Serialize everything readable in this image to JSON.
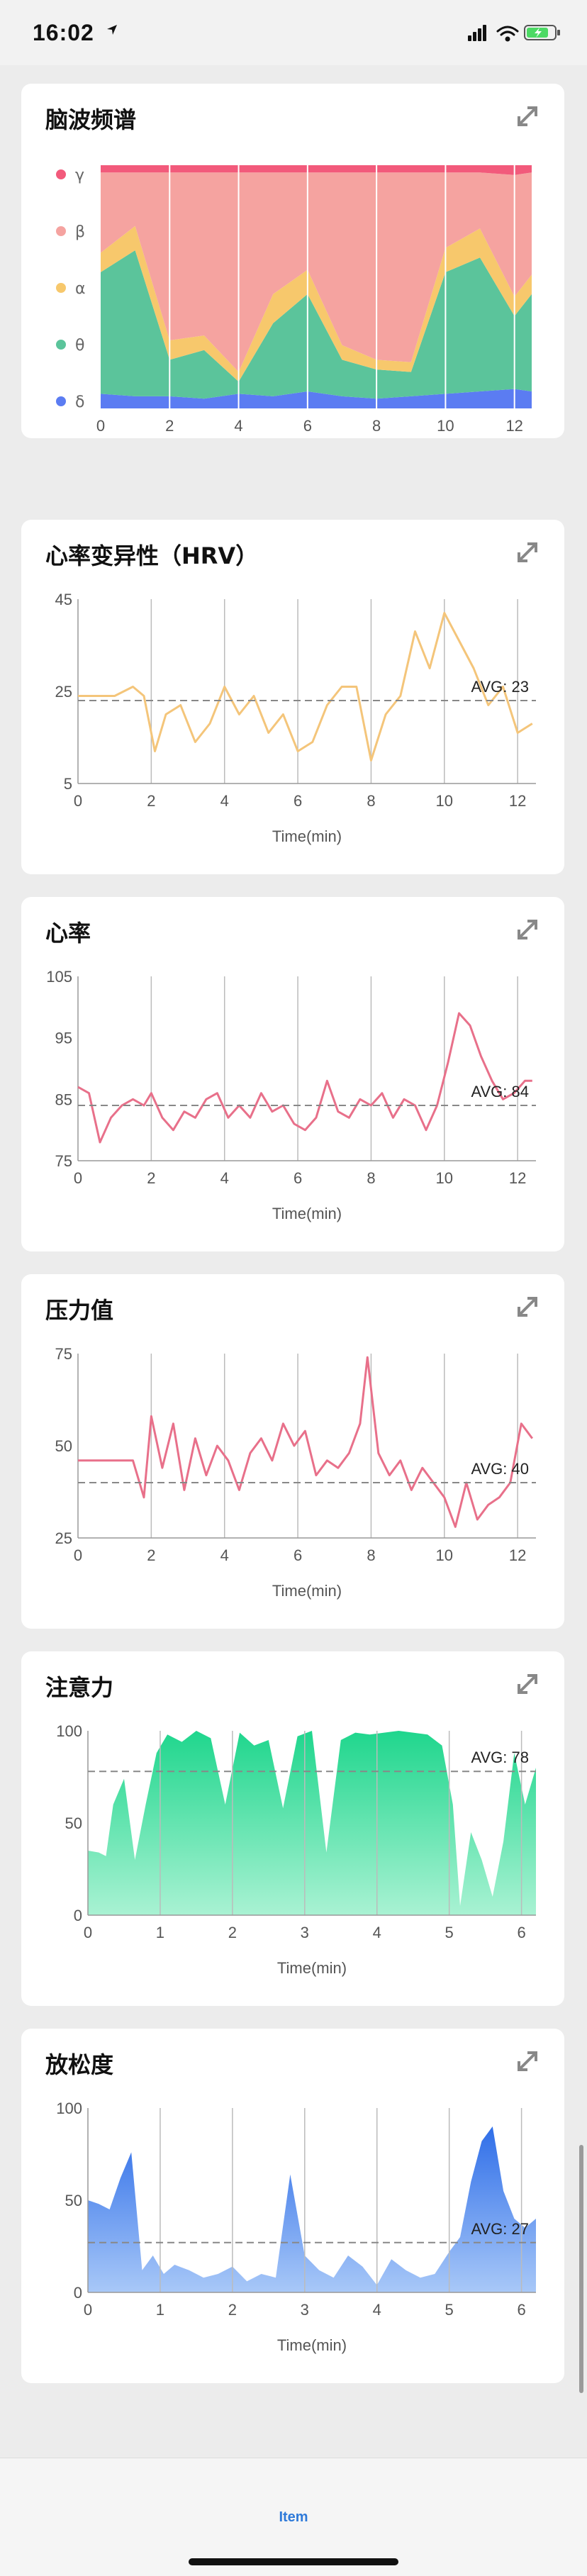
{
  "status": {
    "time": "16:02"
  },
  "cards": [
    {
      "title": "脑波频谱",
      "xlabel": "Time(min)",
      "xticks": [
        "0",
        "2",
        "4",
        "6",
        "8",
        "10",
        "12"
      ],
      "legend": [
        {
          "label": "γ",
          "color": "#f25a7b"
        },
        {
          "label": "β",
          "color": "#f5a3a0"
        },
        {
          "label": "α",
          "color": "#f7c86c"
        },
        {
          "label": "θ",
          "color": "#5bc49b"
        },
        {
          "label": "δ",
          "color": "#5b7cf2"
        }
      ]
    },
    {
      "title": "心率变异性（HRV）",
      "xlabel": "Time(min)",
      "xticks": [
        "0",
        "2",
        "4",
        "6",
        "8",
        "10",
        "12"
      ],
      "yticks": [
        "45",
        "25",
        "5"
      ],
      "avg": "AVG: 23"
    },
    {
      "title": "心率",
      "xlabel": "Time(min)",
      "xticks": [
        "0",
        "2",
        "4",
        "6",
        "8",
        "10",
        "12"
      ],
      "yticks": [
        "105",
        "95",
        "85",
        "75"
      ],
      "avg": "AVG: 84"
    },
    {
      "title": "压力值",
      "xlabel": "Time(min)",
      "xticks": [
        "0",
        "2",
        "4",
        "6",
        "8",
        "10",
        "12"
      ],
      "yticks": [
        "75",
        "50",
        "25"
      ],
      "avg": "AVG: 40"
    },
    {
      "title": "注意力",
      "xlabel": "Time(min)",
      "xticks": [
        "0",
        "1",
        "2",
        "3",
        "4",
        "5",
        "6"
      ],
      "yticks": [
        "100",
        "50",
        "0"
      ],
      "avg": "AVG: 78"
    },
    {
      "title": "放松度",
      "xlabel": "Time(min)",
      "xticks": [
        "0",
        "1",
        "2",
        "3",
        "4",
        "5",
        "6"
      ],
      "yticks": [
        "100",
        "50",
        "0"
      ],
      "avg": "AVG: 27"
    }
  ],
  "chart_data": [
    {
      "type": "area",
      "title": "脑波频谱",
      "xlabel": "Time(min)",
      "xlim": [
        0,
        12.5
      ],
      "ylim": [
        0,
        1
      ],
      "series": [
        {
          "name": "δ",
          "x": [
            0,
            1,
            2,
            3,
            4,
            5,
            6,
            7,
            8,
            9,
            10,
            11,
            12,
            12.5
          ],
          "values": [
            0.06,
            0.05,
            0.05,
            0.04,
            0.06,
            0.05,
            0.07,
            0.05,
            0.04,
            0.05,
            0.06,
            0.07,
            0.08,
            0.07
          ]
        },
        {
          "name": "θ",
          "x": [
            0,
            1,
            2,
            3,
            4,
            5,
            6,
            7,
            8,
            9,
            10,
            11,
            12,
            12.5
          ],
          "values": [
            0.5,
            0.6,
            0.15,
            0.2,
            0.05,
            0.3,
            0.4,
            0.15,
            0.12,
            0.1,
            0.5,
            0.55,
            0.3,
            0.4
          ]
        },
        {
          "name": "α",
          "x": [
            0,
            1,
            2,
            3,
            4,
            5,
            6,
            7,
            8,
            9,
            10,
            11,
            12,
            12.5
          ],
          "values": [
            0.08,
            0.1,
            0.08,
            0.06,
            0.04,
            0.12,
            0.1,
            0.06,
            0.04,
            0.04,
            0.1,
            0.12,
            0.08,
            0.08
          ]
        },
        {
          "name": "β",
          "x": [
            0,
            1,
            2,
            3,
            4,
            5,
            6,
            7,
            8,
            9,
            10,
            11,
            12,
            12.5
          ],
          "values": [
            0.33,
            0.22,
            0.69,
            0.67,
            0.82,
            0.5,
            0.4,
            0.71,
            0.77,
            0.78,
            0.31,
            0.23,
            0.5,
            0.42
          ]
        },
        {
          "name": "γ",
          "x": [
            0,
            1,
            2,
            3,
            4,
            5,
            6,
            7,
            8,
            9,
            10,
            11,
            12,
            12.5
          ],
          "values": [
            0.03,
            0.03,
            0.03,
            0.03,
            0.03,
            0.03,
            0.03,
            0.03,
            0.03,
            0.03,
            0.03,
            0.03,
            0.04,
            0.03
          ]
        }
      ]
    },
    {
      "type": "line",
      "title": "心率变异性（HRV）",
      "xlabel": "Time(min)",
      "xlim": [
        0,
        12.5
      ],
      "ylim": [
        5,
        45
      ],
      "avg": 23,
      "x": [
        0,
        0.5,
        1,
        1.5,
        1.8,
        2.1,
        2.4,
        2.8,
        3.2,
        3.6,
        4,
        4.4,
        4.8,
        5.2,
        5.6,
        6,
        6.4,
        6.8,
        7.2,
        7.6,
        8,
        8.4,
        8.8,
        9.2,
        9.6,
        10,
        10.4,
        10.8,
        11.2,
        11.6,
        12,
        12.4
      ],
      "values": [
        24,
        24,
        24,
        26,
        24,
        12,
        20,
        22,
        14,
        18,
        26,
        20,
        24,
        16,
        20,
        12,
        14,
        22,
        26,
        26,
        10,
        20,
        24,
        38,
        30,
        42,
        36,
        30,
        22,
        26,
        16,
        18
      ]
    },
    {
      "type": "line",
      "title": "心率",
      "xlabel": "Time(min)",
      "xlim": [
        0,
        12.5
      ],
      "ylim": [
        75,
        105
      ],
      "avg": 84,
      "x": [
        0,
        0.3,
        0.6,
        0.9,
        1.2,
        1.5,
        1.8,
        2,
        2.3,
        2.6,
        2.9,
        3.2,
        3.5,
        3.8,
        4.1,
        4.4,
        4.7,
        5,
        5.3,
        5.6,
        5.9,
        6.2,
        6.5,
        6.8,
        7.1,
        7.4,
        7.7,
        8,
        8.3,
        8.6,
        8.9,
        9.2,
        9.5,
        9.8,
        10.1,
        10.4,
        10.7,
        11,
        11.3,
        11.6,
        11.9,
        12.2,
        12.4
      ],
      "values": [
        87,
        86,
        78,
        82,
        84,
        85,
        84,
        86,
        82,
        80,
        83,
        82,
        85,
        86,
        82,
        84,
        82,
        86,
        83,
        84,
        81,
        80,
        82,
        88,
        83,
        82,
        85,
        84,
        86,
        82,
        85,
        84,
        80,
        84,
        91,
        99,
        97,
        92,
        88,
        85,
        86,
        88,
        88
      ]
    },
    {
      "type": "line",
      "title": "压力值",
      "xlabel": "Time(min)",
      "xlim": [
        0,
        12.5
      ],
      "ylim": [
        25,
        75
      ],
      "avg": 40,
      "x": [
        0,
        0.5,
        1,
        1.5,
        1.8,
        2,
        2.3,
        2.6,
        2.9,
        3.2,
        3.5,
        3.8,
        4.1,
        4.4,
        4.7,
        5,
        5.3,
        5.6,
        5.9,
        6.2,
        6.5,
        6.8,
        7.1,
        7.4,
        7.7,
        7.9,
        8.2,
        8.5,
        8.8,
        9.1,
        9.4,
        9.7,
        10,
        10.3,
        10.6,
        10.9,
        11.2,
        11.5,
        11.8,
        12.1,
        12.4
      ],
      "values": [
        46,
        46,
        46,
        46,
        36,
        58,
        44,
        56,
        38,
        52,
        42,
        50,
        46,
        38,
        48,
        52,
        46,
        56,
        50,
        54,
        42,
        46,
        44,
        48,
        56,
        74,
        48,
        42,
        46,
        38,
        44,
        40,
        36,
        28,
        40,
        30,
        34,
        36,
        40,
        56,
        52
      ]
    },
    {
      "type": "area",
      "title": "注意力",
      "xlabel": "Time(min)",
      "xlim": [
        0,
        6.2
      ],
      "ylim": [
        0,
        100
      ],
      "avg": 78,
      "x": [
        0,
        0.15,
        0.25,
        0.35,
        0.5,
        0.65,
        0.8,
        0.95,
        1.1,
        1.3,
        1.5,
        1.7,
        1.9,
        2.1,
        2.3,
        2.5,
        2.7,
        2.9,
        3.1,
        3.3,
        3.5,
        3.7,
        3.9,
        4.1,
        4.3,
        4.5,
        4.7,
        4.9,
        5.05,
        5.15,
        5.3,
        5.45,
        5.6,
        5.75,
        5.9,
        6.05,
        6.2
      ],
      "values": [
        35,
        34,
        32,
        60,
        74,
        30,
        60,
        88,
        98,
        94,
        100,
        96,
        60,
        99,
        92,
        95,
        58,
        97,
        100,
        34,
        95,
        99,
        98,
        99,
        100,
        99,
        98,
        92,
        60,
        5,
        45,
        30,
        10,
        40,
        88,
        60,
        80
      ]
    },
    {
      "type": "area",
      "title": "放松度",
      "xlabel": "Time(min)",
      "xlim": [
        0,
        6.2
      ],
      "ylim": [
        0,
        100
      ],
      "avg": 27,
      "x": [
        0,
        0.15,
        0.3,
        0.45,
        0.6,
        0.75,
        0.9,
        1.05,
        1.2,
        1.4,
        1.6,
        1.8,
        2,
        2.2,
        2.4,
        2.6,
        2.8,
        3,
        3.2,
        3.4,
        3.6,
        3.8,
        4,
        4.2,
        4.4,
        4.6,
        4.8,
        5,
        5.15,
        5.3,
        5.45,
        5.6,
        5.75,
        5.9,
        6.05,
        6.2
      ],
      "values": [
        50,
        48,
        45,
        62,
        76,
        12,
        20,
        10,
        15,
        12,
        8,
        10,
        14,
        6,
        10,
        8,
        64,
        20,
        12,
        8,
        20,
        14,
        4,
        18,
        12,
        8,
        10,
        22,
        30,
        60,
        82,
        90,
        55,
        40,
        35,
        40
      ]
    }
  ]
}
